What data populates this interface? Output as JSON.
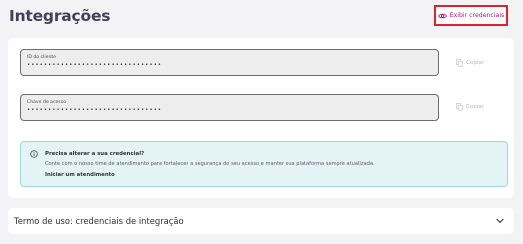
{
  "page": {
    "title": "Integrações"
  },
  "toolbar": {
    "show_credentials_label": "Exibir credenciais"
  },
  "credentials": {
    "client_id": {
      "label": "ID do cliente",
      "value": "••••••••••••••••••••••••••••••••"
    },
    "access_key": {
      "label": "Chave de acesso",
      "value": "••••••••••••••••••••••••••••••••"
    },
    "copy_label": "Copiar"
  },
  "notice": {
    "title": "Precisa alterar a sua credencial?",
    "text": "Conte com o nosso time de atendimento para fortalecer a segurança do seu acesso e manter sua plataforma sempre atualizada.",
    "link": "Iniciar um atendimento"
  },
  "terms": {
    "title": "Termo de uso: credenciais de integração"
  },
  "icons": {
    "eye": "eye-icon",
    "copy": "copy-icon",
    "info": "info-icon",
    "chevron": "chevron-down-icon"
  },
  "colors": {
    "accent": "#b4167a",
    "highlight_border": "#e0202f",
    "notice_bg": "#e4f3f5",
    "notice_border": "#9fd6dc"
  }
}
